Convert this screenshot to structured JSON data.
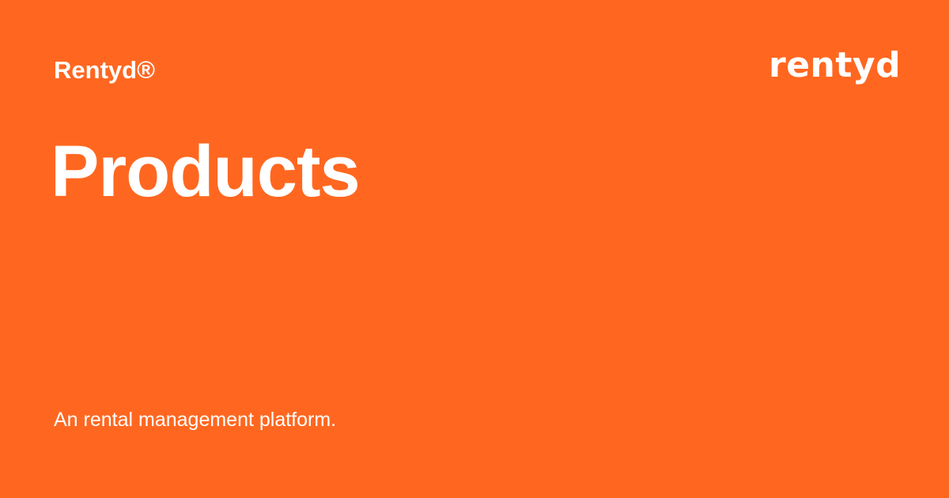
{
  "brand": {
    "name": "Rentyd®",
    "logo_text": "rentyd"
  },
  "page": {
    "title": "Products",
    "tagline": "An rental management platform."
  },
  "colors": {
    "background": "#FF6720",
    "text": "#FFFFFF"
  }
}
